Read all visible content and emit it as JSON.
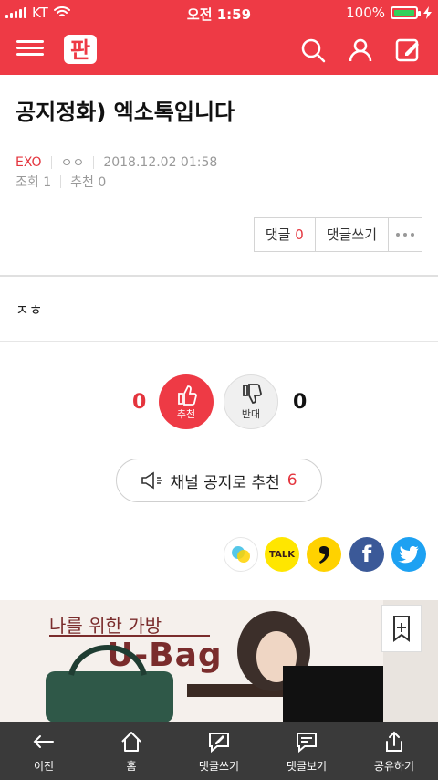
{
  "status": {
    "carrier": "KT",
    "time": "오전 1:59",
    "battery": "100%"
  },
  "app": {
    "logo_text": "판"
  },
  "post": {
    "title": "공지정화) 엑소톡입니다",
    "channel": "EXO",
    "author": "ㅇㅇ",
    "date": "2018.12.02 01:58",
    "views_label": "조회 1",
    "likes_label": "추천 0",
    "body": "ㅈㅎ"
  },
  "actions": {
    "comment_label": "댓글",
    "comment_count": "0",
    "write_label": "댓글쓰기"
  },
  "vote": {
    "up_count": "0",
    "up_label": "추천",
    "down_count": "0",
    "down_label": "반대"
  },
  "notice": {
    "label": "채널 공지로 추천",
    "count": "6"
  },
  "share": {
    "talk_label": "TALK",
    "facebook_label": "f"
  },
  "ad": {
    "title1": "나를 위한 가방",
    "title2": "U-Bag"
  },
  "bottom": {
    "prev": "이전",
    "home": "홈",
    "write": "댓글쓰기",
    "view": "댓글보기",
    "share": "공유하기"
  },
  "colors": {
    "brand": "#ee3a45",
    "accent": "#e4343d"
  }
}
